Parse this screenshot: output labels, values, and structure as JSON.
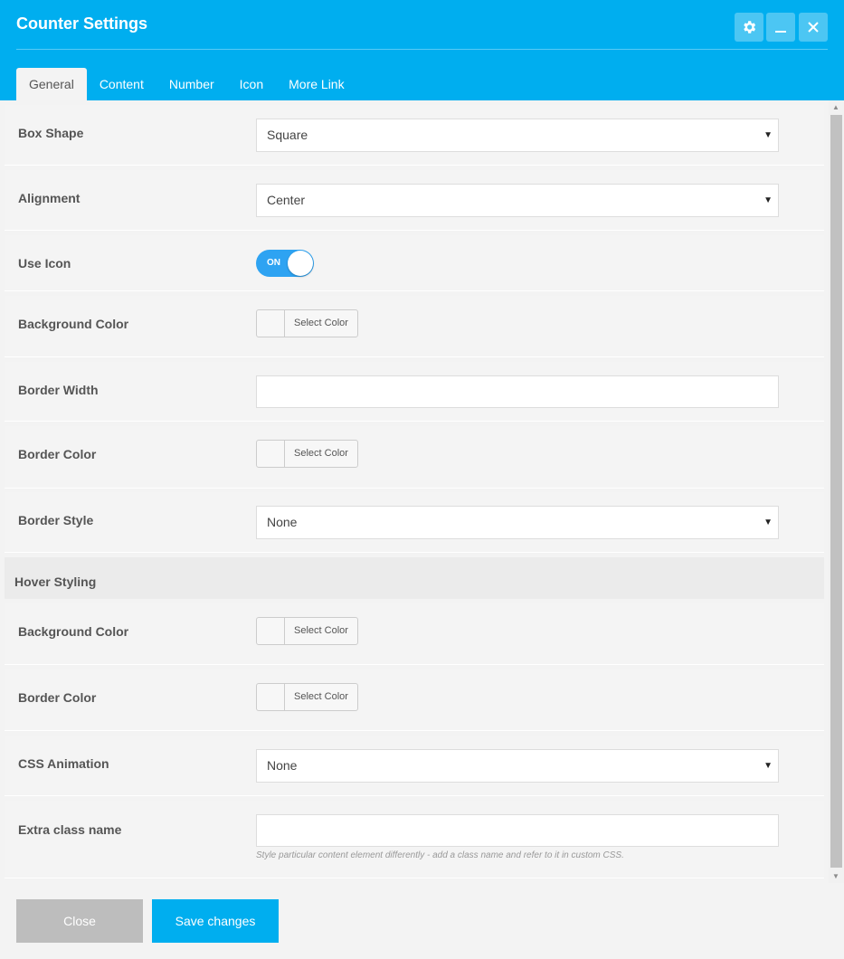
{
  "window": {
    "title": "Counter Settings",
    "buttons": {
      "settings_icon": "gear-icon",
      "minimize_icon": "minimize-icon",
      "close_icon": "close-icon"
    }
  },
  "tabs": [
    {
      "label": "General",
      "active": true
    },
    {
      "label": "Content",
      "active": false
    },
    {
      "label": "Number",
      "active": false
    },
    {
      "label": "Icon",
      "active": false
    },
    {
      "label": "More Link",
      "active": false
    }
  ],
  "fields": {
    "box_shape": {
      "label": "Box Shape",
      "value": "Square"
    },
    "alignment": {
      "label": "Alignment",
      "value": "Center"
    },
    "use_icon": {
      "label": "Use Icon",
      "state": "ON"
    },
    "background_color": {
      "label": "Background Color",
      "button": "Select Color"
    },
    "border_width": {
      "label": "Border Width",
      "value": ""
    },
    "border_color": {
      "label": "Border Color",
      "button": "Select Color"
    },
    "border_style": {
      "label": "Border Style",
      "value": "None"
    },
    "hover_section": {
      "label": "Hover Styling"
    },
    "hover_background_color": {
      "label": "Background Color",
      "button": "Select Color"
    },
    "hover_border_color": {
      "label": "Border Color",
      "button": "Select Color"
    },
    "css_animation": {
      "label": "CSS Animation",
      "value": "None"
    },
    "extra_class": {
      "label": "Extra class name",
      "value": "",
      "help": "Style particular content element differently - add a class name and refer to it in custom CSS."
    }
  },
  "footer": {
    "close_label": "Close",
    "save_label": "Save changes"
  },
  "colors": {
    "header": "#00aeef",
    "toggle_on": "#2ea3f2",
    "save_button": "#00aeef",
    "close_button": "#bdbdbd"
  }
}
